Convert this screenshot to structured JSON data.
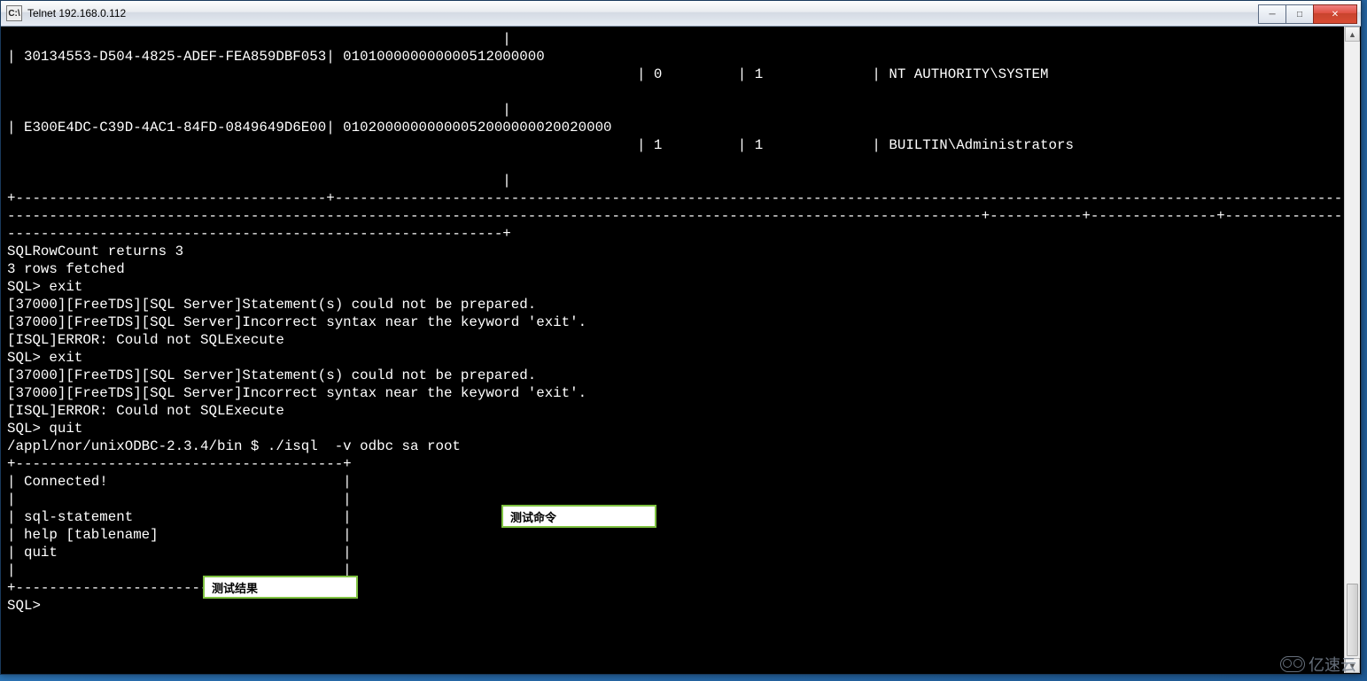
{
  "window": {
    "title": "Telnet 192.168.0.112",
    "icon_label": "C:\\"
  },
  "controls": {
    "minimize": "─",
    "maximize": "□",
    "close": "✕"
  },
  "terminal_lines": [
    "                                                           |",
    "| 30134553-D504-4825-ADEF-FEA859DBF053| 010100000000000512000000",
    "                                                                           | 0         | 1             | NT AUTHORITY\\SYSTEM",
    "",
    "                                                           |",
    "| E300E4DC-C39D-4AC1-84FD-0849649D6E00| 01020000000000052000000020020000",
    "                                                                           | 1         | 1             | BUILTIN\\Administrators",
    "",
    "                                                           |",
    "+-------------------------------------+---------------------------------------------------------------------------------------------------------------------------------------------------",
    "--------------------------------------------------------------------------------------------------------------------+-----------+---------------+----------------------------------------",
    "-----------------------------------------------------------+",
    "SQLRowCount returns 3",
    "3 rows fetched",
    "SQL> exit",
    "[37000][FreeTDS][SQL Server]Statement(s) could not be prepared.",
    "[37000][FreeTDS][SQL Server]Incorrect syntax near the keyword 'exit'.",
    "[ISQL]ERROR: Could not SQLExecute",
    "SQL> exit",
    "[37000][FreeTDS][SQL Server]Statement(s) could not be prepared.",
    "[37000][FreeTDS][SQL Server]Incorrect syntax near the keyword 'exit'.",
    "[ISQL]ERROR: Could not SQLExecute",
    "SQL> quit",
    "/appl/nor/unixODBC-2.3.4/bin $ ./isql  -v odbc sa root",
    "+---------------------------------------+",
    "| Connected!                            |",
    "|                                       |",
    "| sql-statement                         |",
    "| help [tablename]                      |",
    "| quit                                  |",
    "|                                       |",
    "+---------------------------------------+",
    "SQL>"
  ],
  "annotations": {
    "cmd": "测试命令",
    "result": "测试结果"
  },
  "watermark": "亿速云"
}
